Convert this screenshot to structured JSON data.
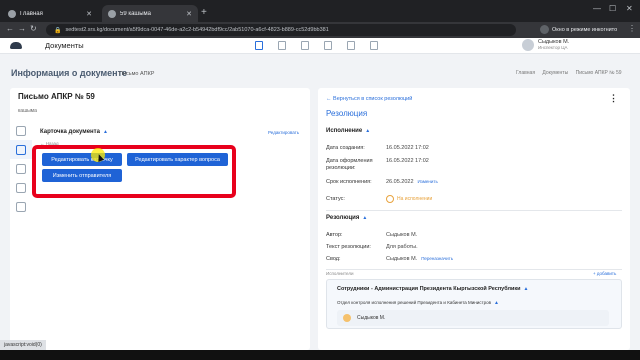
{
  "browser": {
    "tabs": [
      {
        "title": "Главная",
        "active": false
      },
      {
        "title": "59 кашыма",
        "active": true
      }
    ],
    "url": "sedtest2.srs.kg/document/a5f9dca-0047-46de-a2c2-b54942bdf9cc/2ab51070-a6cf-4823-b889-cc52d9bb381",
    "incognito_label": "Окно в режиме инкогнито"
  },
  "app": {
    "module_title": "Документы",
    "user": {
      "name": "Сыдыков М.",
      "role": "Инспектор ЦА"
    }
  },
  "page": {
    "title": "Информация о документе",
    "subtitle": "Письмо АПКР",
    "breadcrumbs": [
      "Главная",
      "Документы",
      "Письмо АПКР № 59"
    ]
  },
  "left": {
    "doc_title": "Письмо АПКР № 59",
    "doc_subtitle": "кашыма",
    "card_header": "Карточка документа",
    "edit_link": "Редактировать",
    "back_link": "Назад",
    "buttons": {
      "edit_card": "Редактировать карточку",
      "edit_question": "Редактировать характер вопроса",
      "change_sender": "Изменить отправителя"
    }
  },
  "right": {
    "back_link": "Вернуться в список резолюций",
    "title": "Резолюция",
    "exec_section": "Исполнение",
    "fields": {
      "created_label": "Дата создания:",
      "created_value": "16.05.2022 17:02",
      "drafted_label": "Дата оформления резолюции:",
      "drafted_value": "16.05.2022 17:02",
      "deadline_label": "Срок исполнения:",
      "deadline_value": "26.05.2022",
      "deadline_change": "Изменить",
      "status_label": "Статус:",
      "status_value": "На исполнении"
    },
    "resolution_section": "Резолюция",
    "res": {
      "author_label": "Автор:",
      "author_value": "Сыдыков М.",
      "text_label": "Текст резолюции:",
      "text_value": "Для работы.",
      "compiled_label": "Свод:",
      "compiled_value": "Сыдыков М.",
      "reassign": "Переназначить"
    },
    "executors_label": "Исполнители",
    "add_executor": "+ добавить",
    "executors": {
      "group": "Сотрудники - Администрация Президента Кыргызской Республики",
      "dept": "Отдел контроля исполнения решений Президента и Кабинета Министров",
      "person": "Сыдыков М."
    }
  },
  "statusbar": "javascript:void(0)",
  "colors": {
    "accent": "#1f63d6",
    "highlight": "#e8001c",
    "status": "#e8a33d"
  }
}
